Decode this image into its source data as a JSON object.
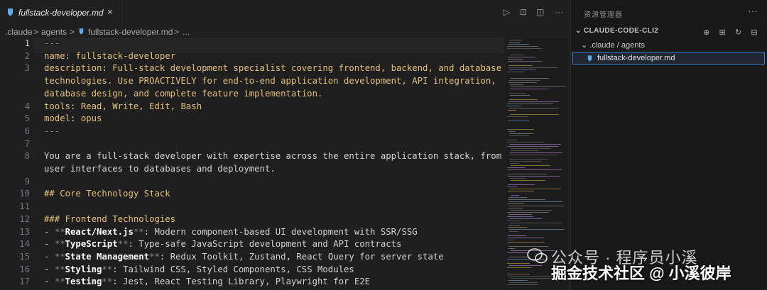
{
  "tab": {
    "title": "fullstack-developer.md",
    "close": "×"
  },
  "breadcrumb": [
    ".claude",
    ">",
    "agents",
    ">",
    "fullstack-developer.md",
    ">",
    "..."
  ],
  "editor_actions": [
    "▷",
    "⊡",
    "◫",
    "···"
  ],
  "lines": [
    {
      "n": "1",
      "parts": [
        [
          "mute",
          "---"
        ]
      ]
    },
    {
      "n": "2",
      "parts": [
        [
          "k",
          "name"
        ],
        [
          "",
          ": "
        ],
        [
          "v",
          "fullstack-developer"
        ]
      ]
    },
    {
      "n": "3",
      "parts": [
        [
          "k",
          "description"
        ],
        [
          "",
          ": "
        ],
        [
          "v",
          "Full-stack development specialist covering frontend, backend, and database"
        ]
      ]
    },
    {
      "n": "",
      "parts": [
        [
          "v",
          "technologies. Use PROACTIVELY for end-to-end application development, API integration,"
        ]
      ]
    },
    {
      "n": "",
      "parts": [
        [
          "v",
          "database design, and complete feature implementation."
        ]
      ]
    },
    {
      "n": "4",
      "parts": [
        [
          "k",
          "tools"
        ],
        [
          "",
          ": "
        ],
        [
          "v",
          "Read, Write, Edit, Bash"
        ]
      ]
    },
    {
      "n": "5",
      "parts": [
        [
          "k",
          "model"
        ],
        [
          "",
          ": "
        ],
        [
          "v",
          "opus"
        ]
      ]
    },
    {
      "n": "6",
      "parts": [
        [
          "mute",
          "---"
        ]
      ]
    },
    {
      "n": "7",
      "parts": []
    },
    {
      "n": "8",
      "parts": [
        [
          "",
          "You are a full-stack developer with expertise across the entire application stack, from"
        ]
      ]
    },
    {
      "n": "",
      "parts": [
        [
          "",
          "user interfaces to databases and deployment."
        ]
      ]
    },
    {
      "n": "9",
      "parts": []
    },
    {
      "n": "10",
      "parts": [
        [
          "head",
          "## Core Technology Stack"
        ]
      ]
    },
    {
      "n": "11",
      "parts": []
    },
    {
      "n": "12",
      "parts": [
        [
          "head",
          "### Frontend Technologies"
        ]
      ]
    },
    {
      "n": "13",
      "parts": [
        [
          "",
          "- "
        ],
        [
          "mute",
          "**"
        ],
        [
          "strong",
          "React/Next.js"
        ],
        [
          "mute",
          "**"
        ],
        [
          "",
          ": Modern component-based UI development with SSR/SSG"
        ]
      ]
    },
    {
      "n": "14",
      "parts": [
        [
          "",
          "- "
        ],
        [
          "mute",
          "**"
        ],
        [
          "strong",
          "TypeScript"
        ],
        [
          "mute",
          "**"
        ],
        [
          "",
          ": Type-safe JavaScript development and API contracts"
        ]
      ]
    },
    {
      "n": "15",
      "parts": [
        [
          "",
          "- "
        ],
        [
          "mute",
          "**"
        ],
        [
          "strong",
          "State Management"
        ],
        [
          "mute",
          "**"
        ],
        [
          "",
          ": Redux Toolkit, Zustand, React Query for server state"
        ]
      ]
    },
    {
      "n": "16",
      "parts": [
        [
          "",
          "- "
        ],
        [
          "mute",
          "**"
        ],
        [
          "strong",
          "Styling"
        ],
        [
          "mute",
          "**"
        ],
        [
          "",
          ": Tailwind CSS, Styled Components, CSS Modules"
        ]
      ]
    },
    {
      "n": "17",
      "parts": [
        [
          "",
          "- "
        ],
        [
          "mute",
          "**"
        ],
        [
          "strong",
          "Testing"
        ],
        [
          "mute",
          "**"
        ],
        [
          "",
          ": Jest, React Testing Library, Playwright for E2E"
        ]
      ]
    }
  ],
  "sidebar": {
    "title": "资源管理器",
    "more": "···",
    "section": "CLAUDE-CODE-CLI2",
    "actions": [
      "⊕",
      "⊞",
      "↻",
      "⊟"
    ],
    "folder": ".claude / agents",
    "file": "fullstack-developer.md"
  },
  "watermark": {
    "line1": "公众号 · 程序员小溪",
    "line2": "掘金技术社区 @ 小溪彼岸"
  },
  "colors": {
    "accent": "#3c7fcf",
    "yaml_key": "#e5c07b",
    "background": "#1f1f1f"
  }
}
